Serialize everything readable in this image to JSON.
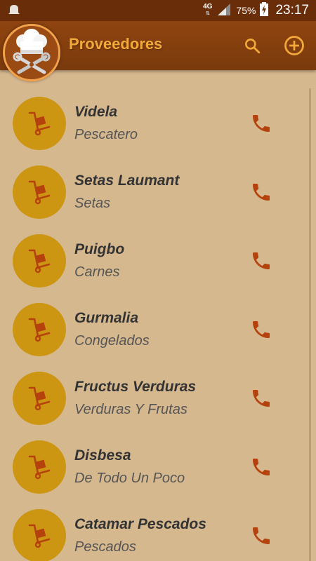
{
  "status_bar": {
    "network_type": "4G",
    "network_arrows": "⇅",
    "battery_percent": "75%",
    "time": "23:17",
    "icons": [
      "notification-bell-icon",
      "signal-icon",
      "battery-charging-icon"
    ]
  },
  "app_bar": {
    "title": "Proveedores",
    "logo_icon": "chef-hat-tools-logo",
    "actions": [
      "search-icon",
      "add-circle-icon"
    ]
  },
  "colors": {
    "status_bar": "#6a2d0a",
    "app_bar": "#8f4410",
    "title": "#f3a93a",
    "background": "#d6b88f",
    "avatar": "#cc9612",
    "call_icon": "#b5420d"
  },
  "suppliers": [
    {
      "name": "Videla",
      "category": "Pescatero"
    },
    {
      "name": "Setas Laumant",
      "category": "Setas"
    },
    {
      "name": "Puigbo",
      "category": "Carnes"
    },
    {
      "name": "Gurmalia",
      "category": "Congelados"
    },
    {
      "name": "Fructus Verduras",
      "category": "Verduras Y Frutas"
    },
    {
      "name": "Disbesa",
      "category": "De Todo Un Poco"
    },
    {
      "name": "Catamar Pescados",
      "category": "Pescados"
    }
  ]
}
